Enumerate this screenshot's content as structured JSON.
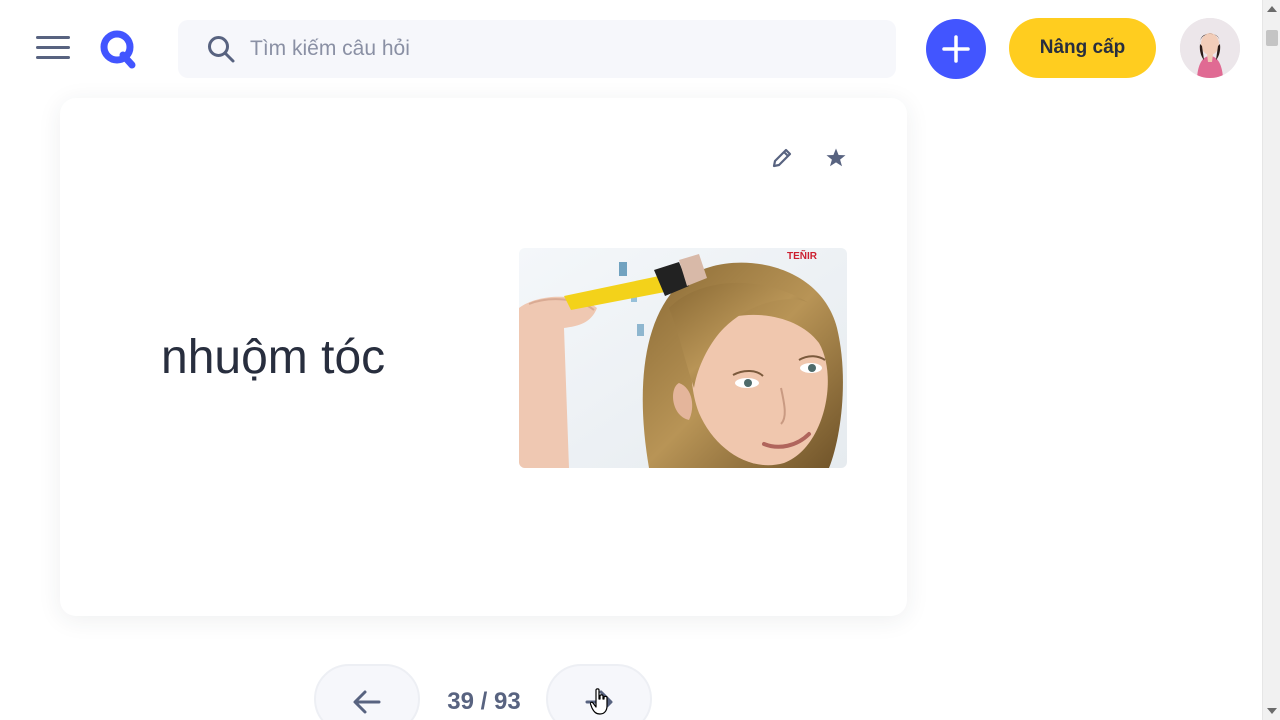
{
  "header": {
    "search_placeholder": "Tìm kiếm câu hỏi",
    "upgrade_label": "Nâng cấp",
    "brand_color": "#4255ff",
    "upgrade_color": "#ffcd1f"
  },
  "card": {
    "term": "nhuộm tóc",
    "image_watermark": "TEÑIR",
    "icons": [
      "edit-icon",
      "star-icon"
    ]
  },
  "pager": {
    "current": "39",
    "total": "93",
    "text": "39 / 93"
  }
}
